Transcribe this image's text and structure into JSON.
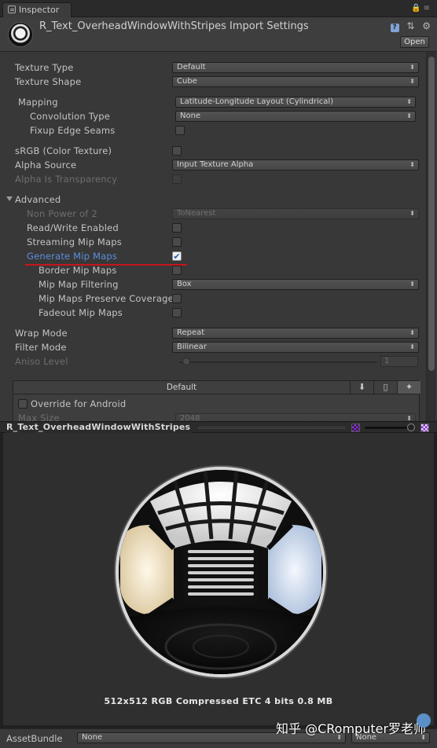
{
  "tab": {
    "label": "Inspector"
  },
  "header": {
    "title": "R_Text_OverheadWindowWithStripes Import Settings",
    "open_label": "Open"
  },
  "fields": {
    "texture_type": {
      "label": "Texture Type",
      "value": "Default"
    },
    "texture_shape": {
      "label": "Texture Shape",
      "value": "Cube"
    },
    "mapping": {
      "label": "Mapping",
      "value": "Latitude-Longitude Layout (Cylindrical)"
    },
    "convolution_type": {
      "label": "Convolution Type",
      "value": "None"
    },
    "fixup_edge_seams": {
      "label": "Fixup Edge Seams",
      "checked": false
    },
    "srgb": {
      "label": "sRGB (Color Texture)",
      "checked": false
    },
    "alpha_source": {
      "label": "Alpha Source",
      "value": "Input Texture Alpha"
    },
    "alpha_is_transparency": {
      "label": "Alpha Is Transparency",
      "checked": false
    },
    "advanced": {
      "label": "Advanced",
      "expanded": true
    },
    "non_power_of_2": {
      "label": "Non Power of 2",
      "value": "ToNearest"
    },
    "read_write": {
      "label": "Read/Write Enabled",
      "checked": false
    },
    "streaming_mip_maps": {
      "label": "Streaming Mip Maps",
      "checked": false
    },
    "generate_mip_maps": {
      "label": "Generate Mip Maps",
      "checked": true,
      "check_glyph": "✔"
    },
    "border_mip_maps": {
      "label": "Border Mip Maps",
      "checked": false
    },
    "mip_map_filtering": {
      "label": "Mip Map Filtering",
      "value": "Box"
    },
    "mip_maps_preserve_coverage": {
      "label": "Mip Maps Preserve Coverage",
      "checked": false
    },
    "fadeout_mip_maps": {
      "label": "Fadeout Mip Maps",
      "checked": false
    },
    "wrap_mode": {
      "label": "Wrap Mode",
      "value": "Repeat"
    },
    "filter_mode": {
      "label": "Filter Mode",
      "value": "Bilinear"
    },
    "aniso_level": {
      "label": "Aniso Level",
      "value": "1",
      "slider_fraction": 0.0
    }
  },
  "platform": {
    "default_label": "Default",
    "override_label": "Override for Android",
    "max_size": {
      "label": "Max Size",
      "value": "2048"
    }
  },
  "preview": {
    "title": "R_Text_OverheadWindowWithStripes",
    "info": "512x512  RGB Compressed ETC 4 bits   0.8 MB"
  },
  "asset_bundle": {
    "label": "AssetBundle",
    "value": "None",
    "variant": "None"
  },
  "watermark": "知乎 @CRomputer罗老师",
  "colors": {
    "highlight": "#5b8fe0",
    "annotation_red": "#c8141c",
    "background": "#383838"
  }
}
